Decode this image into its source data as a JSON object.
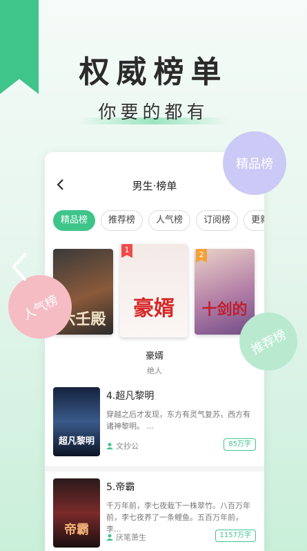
{
  "hero": {
    "title": "权威榜单",
    "subtitle": "你要的都有"
  },
  "nav": {
    "title": "男生·榜单"
  },
  "tabs": [
    {
      "label": "精品榜",
      "active": true
    },
    {
      "label": "推荐榜",
      "active": false
    },
    {
      "label": "人气榜",
      "active": false
    },
    {
      "label": "订阅榜",
      "active": false
    },
    {
      "label": "更新榜",
      "active": false
    }
  ],
  "podium": {
    "left": {
      "cover_text": "六壬殿"
    },
    "center": {
      "rank": "1",
      "cover_text": "豪婿"
    },
    "right": {
      "rank": "2",
      "cover_text": "十剑的"
    }
  },
  "featured": {
    "title": "豪婿",
    "author": "绝人"
  },
  "books": [
    {
      "title": "4.超凡黎明",
      "description": "穿越之后才发现，东方有灵气复苏，西方有诸神黎明。 ...",
      "author": "文抄公",
      "words": "85万字",
      "cover_text": "超凡黎明"
    },
    {
      "title": "5.帝霸",
      "description": "千万年前，李七夜栽下一株翠竹。八百万年前，李七夜养了一条鲤鱼。五百万年前，李...",
      "author": "厌笔萧生",
      "words": "1157万字",
      "cover_text": "帝霸"
    }
  ],
  "bubbles": {
    "top_right": "精品榜",
    "left": "人气榜",
    "right": "推荐榜"
  },
  "colors": {
    "accent": "#3fc48a",
    "bubble_purple": "#cbc9f5",
    "bubble_pink": "#f6bcc4",
    "bubble_green": "#b9ead0"
  }
}
